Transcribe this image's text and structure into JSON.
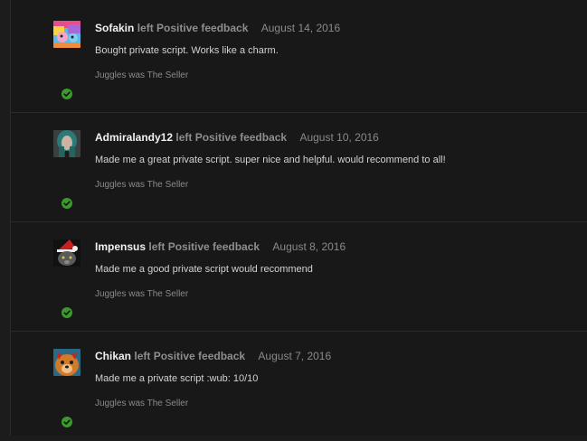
{
  "feedback": [
    {
      "user": "Sofakin",
      "action": "left Positive feedback",
      "date": "August 14, 2016",
      "message": "Bought private script. Works like a charm.",
      "role": "Juggles was The Seller",
      "avatar": "pony-avatar",
      "status_icon": "check-circle-icon",
      "status_color": "#3b9a2c"
    },
    {
      "user": "Admiralandy12",
      "action": "left Positive feedback",
      "date": "August 10, 2016",
      "message": "Made me a great private script. super nice and helpful. would recommend to all!",
      "role": "Juggles was The Seller",
      "avatar": "teal-hair-avatar",
      "status_icon": "check-circle-icon",
      "status_color": "#3b9a2c"
    },
    {
      "user": "Impensus",
      "action": "left Positive feedback",
      "date": "August 8, 2016",
      "message": "Made me a good private script would recommend",
      "role": "Juggles was The Seller",
      "avatar": "santa-cat-avatar",
      "status_icon": "check-circle-icon",
      "status_color": "#3b9a2c"
    },
    {
      "user": "Chikan",
      "action": "left Positive feedback",
      "date": "August 7, 2016",
      "message": "Made me a private script :wub: 10/10",
      "role": "Juggles was The Seller",
      "avatar": "dog-avatar",
      "status_icon": "check-circle-icon",
      "status_color": "#3b9a2c"
    }
  ]
}
